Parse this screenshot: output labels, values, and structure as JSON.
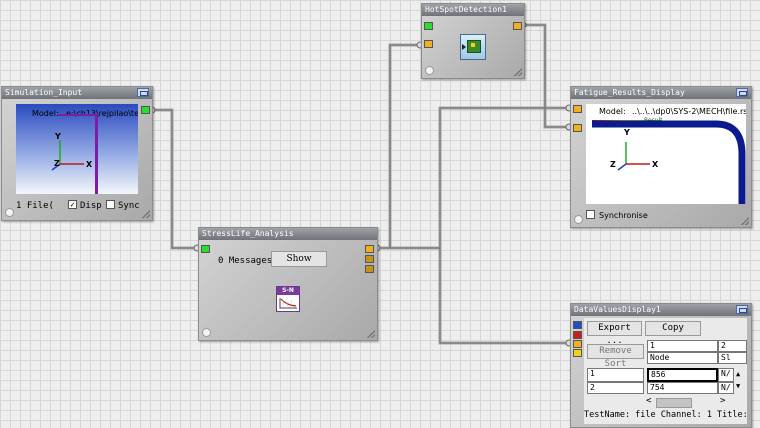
{
  "nodes": {
    "simulation_input": {
      "title": "Simulation_Input",
      "viewport_model": "Model:",
      "viewport_path": "e:\\ch13\\rejpilao\\tes",
      "files_label": "1 File(",
      "disp_label": "Disp",
      "disp_checked": true,
      "sync_label": "Sync",
      "sync_checked": false,
      "axis_y": "Y",
      "axis_z": "Z",
      "axis_x": "X"
    },
    "hotspot": {
      "title": "HotSpotDetection1"
    },
    "fatigue": {
      "title": "Fatigue_Results_Display",
      "model_label": "Model:",
      "model_path": "..\\..\\..\\dp0\\SYS-2\\MECH\\file.rs",
      "legend_text": "Result",
      "axis_y": "Y",
      "axis_z": "Z",
      "axis_x": "X",
      "synchronise_label": "Synchronise",
      "synchronise_checked": false
    },
    "stresslife": {
      "title": "StressLife_Analysis",
      "messages_label": "0 Messages",
      "show_button": "Show",
      "icon_label": "S-N"
    },
    "datavalues": {
      "title": "DataValuesDisplay1",
      "export_button": "Export ...",
      "copy_button": "Copy",
      "remove_sort_button": "Remove Sort",
      "col_header_1": "1",
      "col_header_2": "2",
      "row_header_node": "Node",
      "row_header_sl": "Sl",
      "rows": [
        {
          "index": "1",
          "node": "856",
          "value": "N/"
        },
        {
          "index": "2",
          "node": "754",
          "value": "N/"
        }
      ],
      "scroll_up": "▲",
      "scroll_down": "▼",
      "scroll_left": "<",
      "scroll_right": ">",
      "footer": "TestName: file  Channel: 1  Title:"
    }
  },
  "colors": {
    "canvas_bg": "#eeeeee",
    "port_input": "#29e029",
    "port_output": "#f0b020",
    "model_geometry": "#7a1fa3",
    "result_curve": "#0b1a8c"
  }
}
